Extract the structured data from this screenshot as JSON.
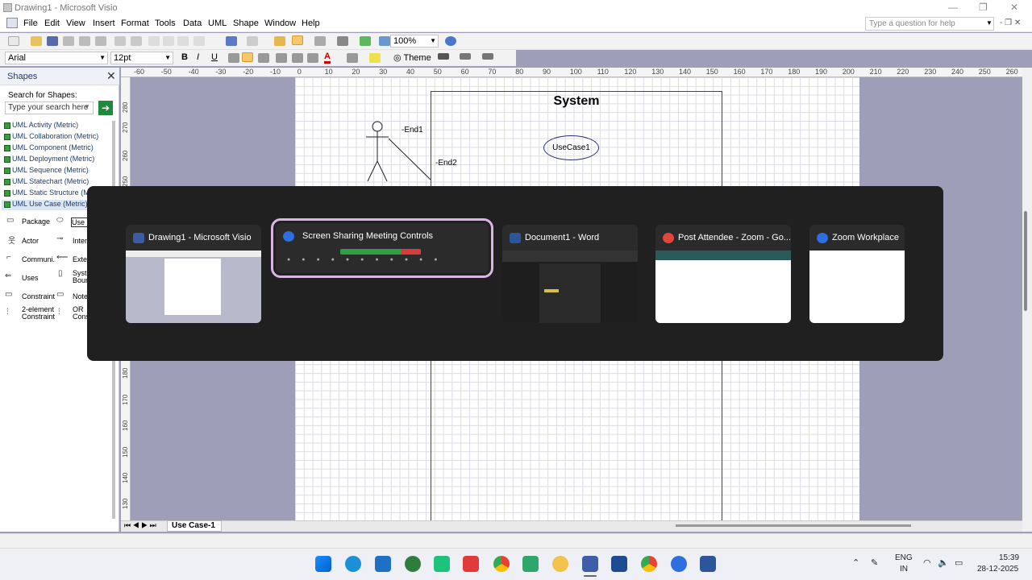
{
  "window": {
    "title": "Drawing1 - Microsoft Visio"
  },
  "menu": [
    "File",
    "Edit",
    "View",
    "Insert",
    "Format",
    "Tools",
    "Data",
    "UML",
    "Shape",
    "Window",
    "Help"
  ],
  "help_placeholder": "Type a question for help",
  "toolbar": {
    "zoom": "100%",
    "font": "Arial",
    "font_size": "12pt",
    "theme_label": "Theme"
  },
  "shapes_panel": {
    "title": "Shapes",
    "search_label": "Search for Shapes:",
    "search_placeholder": "Type your search here",
    "stencils": [
      "UML Activity (Metric)",
      "UML Collaboration (Metric)",
      "UML Component (Metric)",
      "UML Deployment (Metric)",
      "UML Sequence (Metric)",
      "UML Statechart (Metric)",
      "UML Static Structure (M",
      "UML Use Case (Metric)"
    ],
    "shapes": [
      "Package",
      "Use C",
      "Actor",
      "Inter",
      "Communi...",
      "Exte",
      "Uses",
      "Syste Boun",
      "Constraint",
      "Note",
      "2-element Constraint",
      "OR Cons"
    ]
  },
  "ruler_top": [
    "-60",
    "-50",
    "-40",
    "-30",
    "-20",
    "-10",
    "0",
    "10",
    "20",
    "30",
    "40",
    "50",
    "60",
    "70",
    "80",
    "90",
    "100",
    "110",
    "120",
    "130",
    "140",
    "150",
    "160",
    "170",
    "180",
    "190",
    "200",
    "210",
    "220",
    "230",
    "240",
    "250",
    "260"
  ],
  "ruler_left": [
    "280",
    "270",
    "260",
    "250",
    "180",
    "170",
    "160",
    "150",
    "140",
    "130"
  ],
  "diagram": {
    "system_title": "System",
    "usecase": "UseCase1",
    "end1": "-End1",
    "end2": "-End2"
  },
  "page_tab": "Use Case-1",
  "switcher": [
    {
      "title": "Drawing1 - Microsoft Visio",
      "color": "#3b5ba5"
    },
    {
      "title": "Screen Sharing Meeting Controls",
      "color": "#2d6fe0"
    },
    {
      "title": "Document1 - Word",
      "color": "#2b579a"
    },
    {
      "title": "Post Attendee - Zoom - Go...",
      "color": "#e0463c"
    },
    {
      "title": "Zoom Workplace",
      "color": "#2d6fe0"
    }
  ],
  "tray": {
    "lang1": "ENG",
    "lang2": "IN",
    "time": "15:39",
    "date": "28-12-2025"
  }
}
